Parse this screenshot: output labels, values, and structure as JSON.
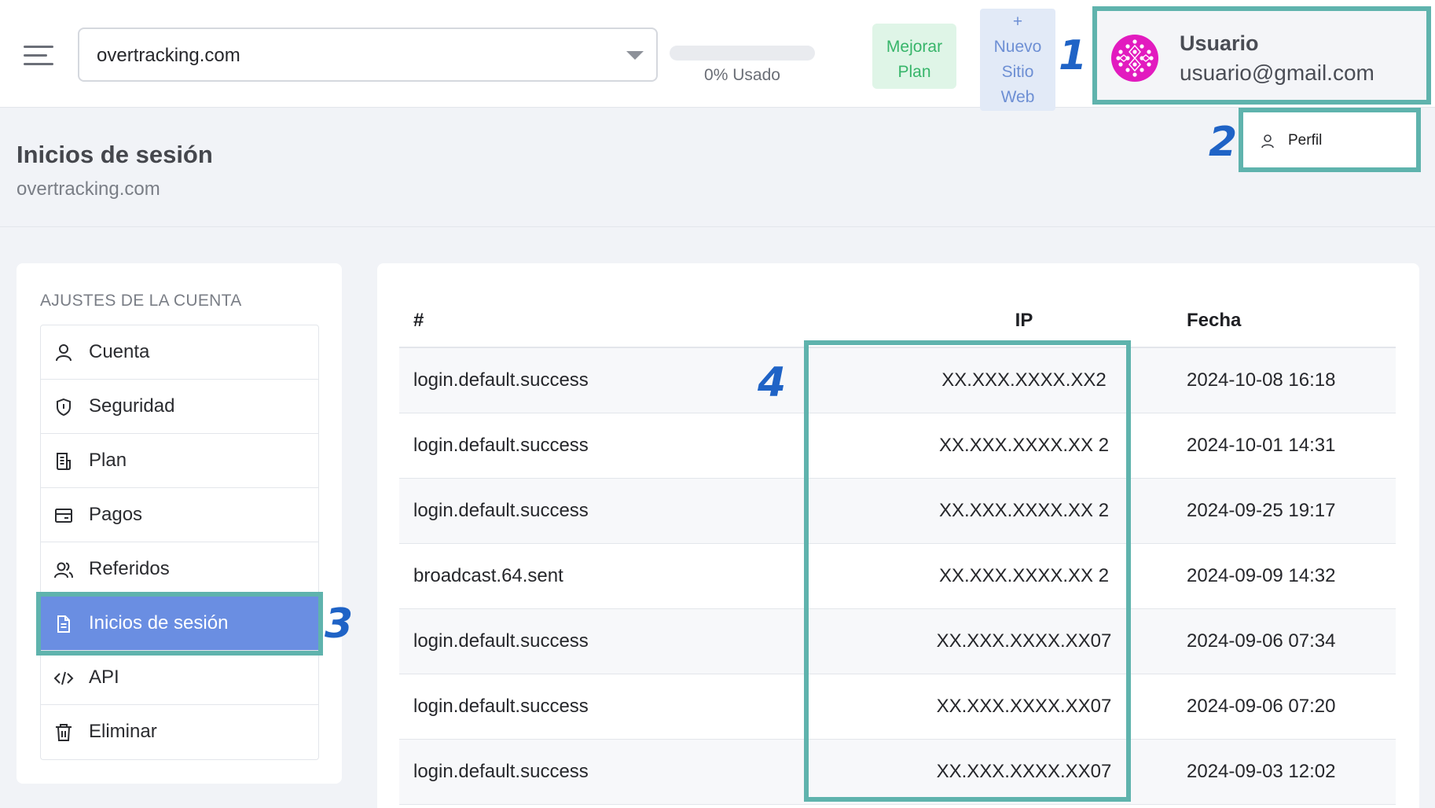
{
  "topbar": {
    "site_select_value": "overtracking.com",
    "usage": {
      "percent": 0,
      "label": "0% Usado"
    },
    "upgrade_label_line1": "Mejorar",
    "upgrade_label_line2": "Plan",
    "new_site_plus": "+",
    "new_site_line1": "Nuevo",
    "new_site_line2": "Sitio",
    "new_site_line3": "Web"
  },
  "user": {
    "name": "Usuario",
    "email": "usuario@gmail.com"
  },
  "profile_menu": {
    "label": "Perfil"
  },
  "markers": [
    "1",
    "2",
    "3",
    "4"
  ],
  "page": {
    "title": "Inicios de sesión",
    "subtitle": "overtracking.com"
  },
  "sidebar": {
    "heading": "AJUSTES DE LA CUENTA",
    "items": [
      {
        "label": "Cuenta",
        "icon": "user-icon"
      },
      {
        "label": "Seguridad",
        "icon": "shield-icon"
      },
      {
        "label": "Plan",
        "icon": "receipt-icon"
      },
      {
        "label": "Pagos",
        "icon": "wallet-icon"
      },
      {
        "label": "Referidos",
        "icon": "users-icon"
      },
      {
        "label": "Inicios de sesión",
        "icon": "document-icon",
        "active": true
      },
      {
        "label": "API",
        "icon": "code-icon"
      },
      {
        "label": "Eliminar",
        "icon": "trash-icon"
      }
    ]
  },
  "table": {
    "headers": [
      "#",
      "IP",
      "Fecha"
    ],
    "rows": [
      {
        "event": "login.default.success",
        "ip": "XX.XXX.XXXX.XX2",
        "date": "2024-10-08 16:18"
      },
      {
        "event": "login.default.success",
        "ip": "XX.XXX.XXXX.XX 2",
        "date": "2024-10-01 14:31"
      },
      {
        "event": "login.default.success",
        "ip": "XX.XXX.XXXX.XX  2",
        "date": "2024-09-25 19:17"
      },
      {
        "event": "broadcast.64.sent",
        "ip": "XX.XXX.XXXX.XX 2",
        "date": "2024-09-09 14:32"
      },
      {
        "event": "login.default.success",
        "ip": "XX.XXX.XXXX.XX07",
        "date": "2024-09-06 07:34"
      },
      {
        "event": "login.default.success",
        "ip": "XX.XXX.XXXX.XX07",
        "date": "2024-09-06 07:20"
      },
      {
        "event": "login.default.success",
        "ip": "XX.XXX.XXXX.XX07",
        "date": "2024-09-03 12:02"
      }
    ]
  },
  "colors": {
    "highlight": "#5fb3ad",
    "marker": "#1f63c6",
    "active_item": "#6a8ee2",
    "upgrade_text": "#37b56a",
    "new_site_text": "#6d8fd4",
    "avatar": "#e21bbf"
  }
}
